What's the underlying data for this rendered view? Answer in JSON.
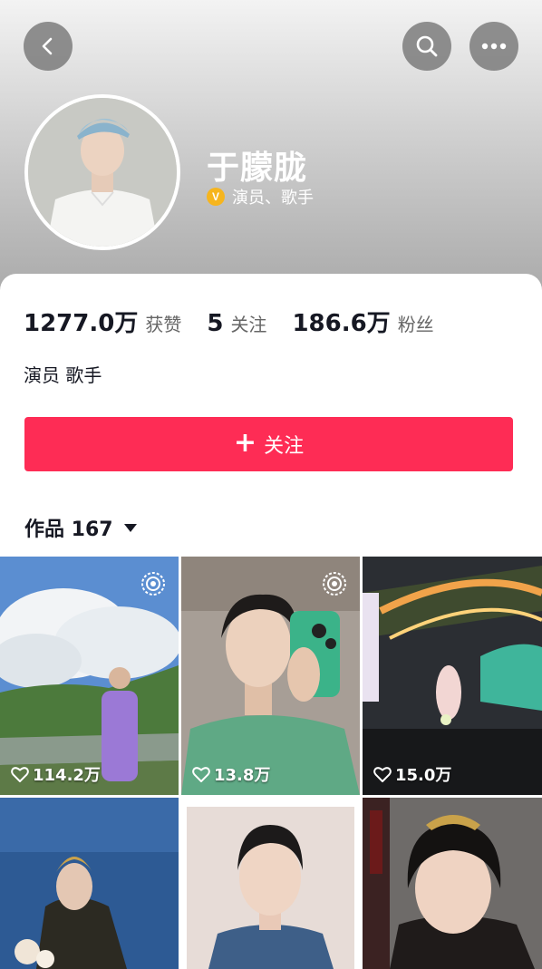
{
  "profile": {
    "name": "于朦胧",
    "verification": "演员、歌手",
    "bio": "演员 歌手"
  },
  "stats": [
    {
      "value": "1277.0万",
      "label": "获赞"
    },
    {
      "value": "5",
      "label": "关注"
    },
    {
      "value": "186.6万",
      "label": "粉丝"
    }
  ],
  "follow_button": {
    "label": "关注"
  },
  "works_tab": {
    "label": "作品 167"
  },
  "videos": [
    {
      "likes": "114.2万",
      "live": true
    },
    {
      "likes": "13.8万",
      "live": true
    },
    {
      "likes": "15.0万",
      "live": false
    },
    {
      "likes": "",
      "live": false
    },
    {
      "likes": "",
      "live": false
    },
    {
      "likes": "",
      "live": false
    }
  ],
  "colors": {
    "accent": "#fe2c55",
    "verify": "#f6b51e"
  },
  "icons": [
    "back-icon",
    "search-icon",
    "more-icon",
    "plus-icon",
    "heart-icon",
    "live-icon",
    "caret-down-icon",
    "verified-icon"
  ]
}
